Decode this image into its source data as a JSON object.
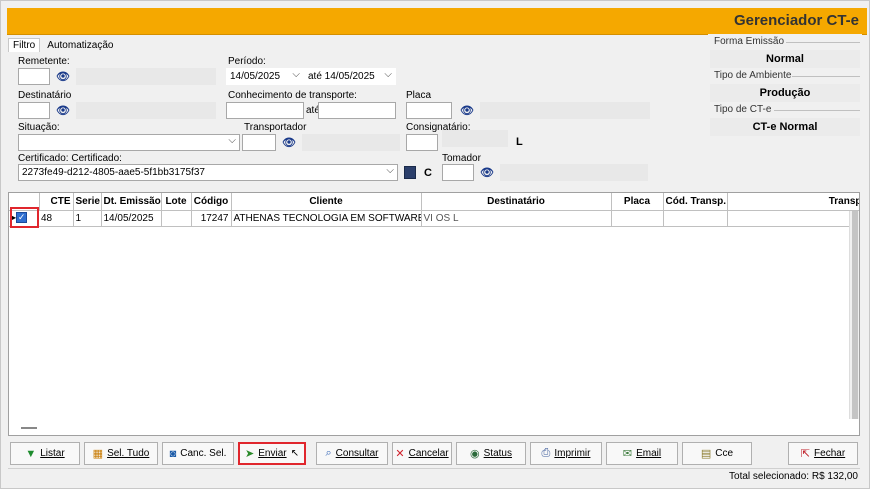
{
  "window": {
    "title": "Gerenciador CT-e"
  },
  "tabs": [
    "Filtro",
    "Automatização"
  ],
  "filters": {
    "remetente_label": "Remetente:",
    "periodo_label": "Período:",
    "periodo_from": "14/05/2025",
    "periodo_ate": "até 14/05/2025",
    "destinatario_label": "Destinatário",
    "conhecimento_label": "Conhecimento de transporte:",
    "conhecimento_ate": "até",
    "placa_label": "Placa",
    "situacao_label": "Situação:",
    "transportador_label": "Transportador",
    "consignatario_label": "Consignatário:",
    "consignatario_code": "L",
    "certificado_label": "Certificado:  Certificado:",
    "certificado_value": "2273fe49-d212-4805-aae5-5f1bb3175f37",
    "certificado_code": "C",
    "tomador_label": "Tomador"
  },
  "right_panel": {
    "forma_emissao_label": "Forma Emissão",
    "forma_emissao_value": "Normal",
    "tipo_ambiente_label": "Tipo de Ambiente",
    "tipo_ambiente_value": "Produção",
    "tipo_cte_label": "Tipo de CT-e",
    "tipo_cte_value": "CT-e Normal"
  },
  "grid": {
    "columns": [
      "CTE",
      "Serie",
      "Dt. Emissão",
      "Lote",
      "Código",
      "Cliente",
      "Destinatário",
      "Placa",
      "Cód. Transp.",
      "Transportad"
    ],
    "rows": [
      {
        "cte": "48",
        "serie": "1",
        "dt_emissao": "14/05/2025",
        "lote": "",
        "codigo": "17247",
        "cliente": "ATHENAS TECNOLOGIA EM SOFTWARES L",
        "destinatario": "VI                                             OS L",
        "placa": "",
        "cod_transp": "",
        "transportador": ""
      }
    ]
  },
  "toolbar": {
    "listar": "Listar",
    "sel_tudo": "Sel. Tudo",
    "canc_sel": "Canc. Sel.",
    "enviar": "Enviar",
    "consultar": "Consultar",
    "cancelar": "Cancelar",
    "status": "Status",
    "imprimir": "Imprimir",
    "email": "Email",
    "cce": "Cce",
    "fechar": "Fechar"
  },
  "status_bar": {
    "total": "Total selecionado: R$ 132,00"
  },
  "colors": {
    "title_bar": "#f5a800",
    "highlight": "#e0262d"
  }
}
